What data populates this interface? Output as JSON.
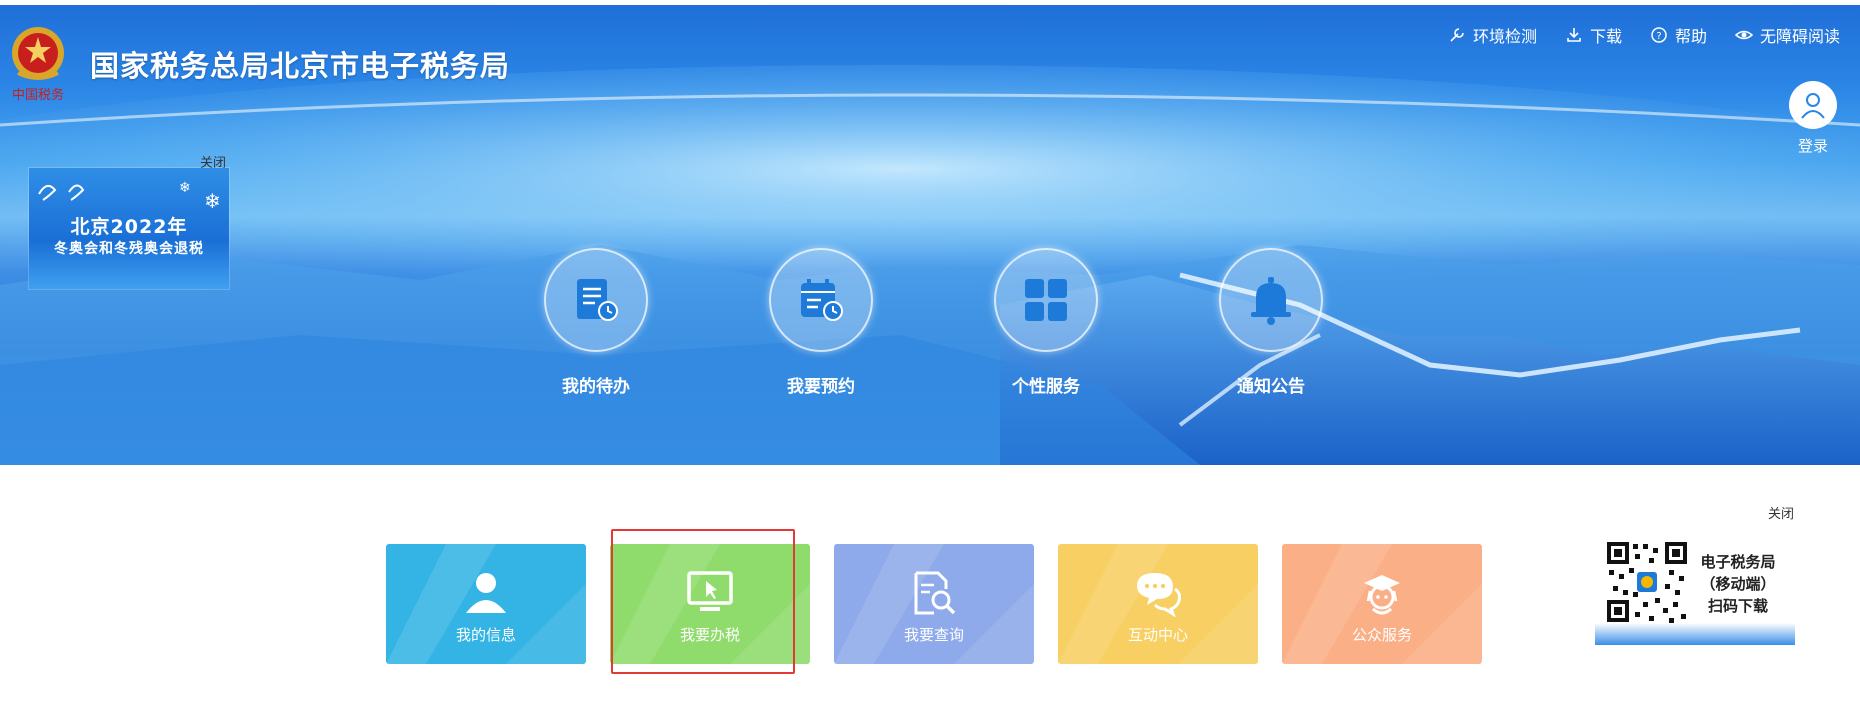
{
  "header": {
    "site_title": "国家税务总局北京市电子税务局",
    "logo_caption": "中国税务",
    "top_links": [
      {
        "label": "环境检测",
        "icon": "wrench-icon"
      },
      {
        "label": "下载",
        "icon": "download-icon"
      },
      {
        "label": "帮助",
        "icon": "help-icon"
      },
      {
        "label": "无障碍阅读",
        "icon": "eye-icon"
      }
    ],
    "login_label": "登录"
  },
  "olympic_banner": {
    "close_label": "关闭",
    "line1": "北京2022年",
    "line2": "冬奥会和冬残奥会退税"
  },
  "features": [
    {
      "label": "我的待办",
      "icon": "todo-document-icon"
    },
    {
      "label": "我要预约",
      "icon": "calendar-clock-icon"
    },
    {
      "label": "个性服务",
      "icon": "grid-icon"
    },
    {
      "label": "通知公告",
      "icon": "bell-icon"
    }
  ],
  "tiles": [
    {
      "label": "我的信息",
      "icon": "user-icon",
      "color": "#33b4e4"
    },
    {
      "label": "我要办税",
      "icon": "monitor-cursor-icon",
      "color": "#8fdc6c"
    },
    {
      "label": "我要查询",
      "icon": "document-search-icon",
      "color": "#8eaaea"
    },
    {
      "label": "互动中心",
      "icon": "chat-bubbles-icon",
      "color": "#f7cf62"
    },
    {
      "label": "公众服务",
      "icon": "service-agent-icon",
      "color": "#fbaf86"
    }
  ],
  "qr_panel": {
    "close_label": "关闭",
    "text_lines": [
      "电子税务局",
      "（移动端）",
      "扫码下载"
    ]
  },
  "colors": {
    "highlight": "#e53935",
    "banner_blue": "#2a86e8"
  }
}
